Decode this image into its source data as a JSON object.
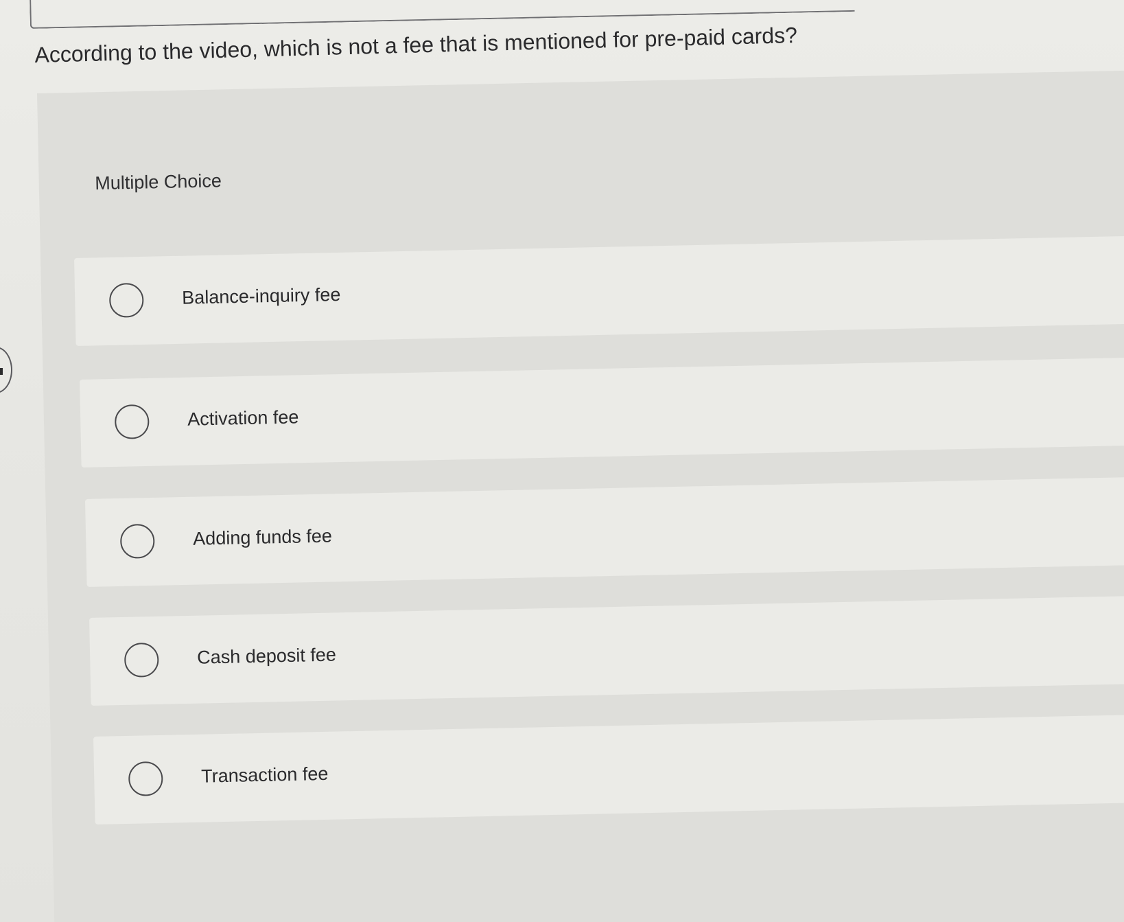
{
  "question": "According to the video, which is not a fee that is mentioned for pre-paid cards?",
  "question_type_label": "Multiple Choice",
  "options": [
    {
      "label": "Balance-inquiry fee"
    },
    {
      "label": "Activation fee"
    },
    {
      "label": "Adding funds fee"
    },
    {
      "label": "Cash deposit fee"
    },
    {
      "label": "Transaction fee"
    }
  ],
  "colors": {
    "page_background": "#e6e6e2",
    "panel_background": "#dededa",
    "option_background": "#ebebe7",
    "text": "#2a2a2c",
    "radio_border": "#4a4a4d"
  },
  "icons": {
    "radio": "radio-unselected-icon"
  }
}
